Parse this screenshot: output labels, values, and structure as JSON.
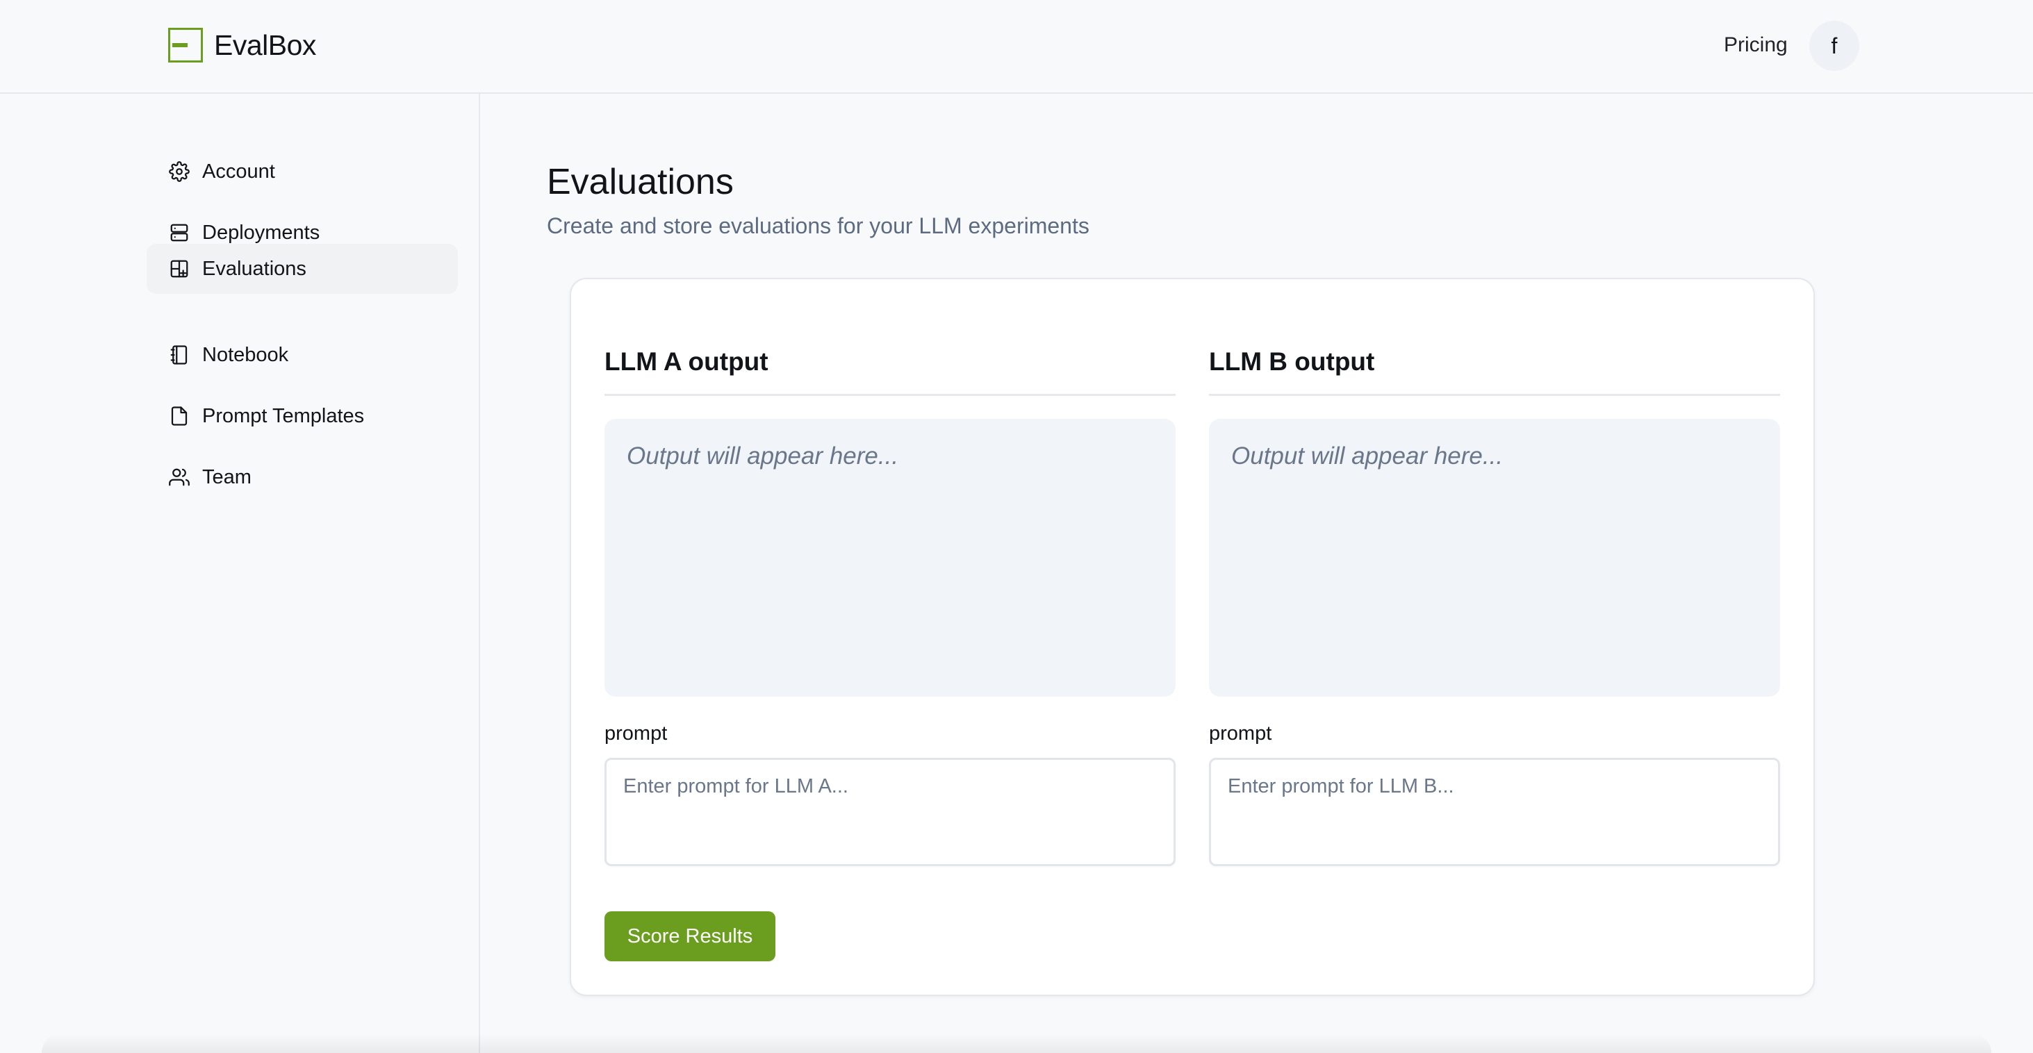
{
  "header": {
    "brand": "EvalBox",
    "pricing_label": "Pricing",
    "avatar_initial": "f",
    "brand_color": "#6b9e1f"
  },
  "sidebar": {
    "items": [
      {
        "label": "Account",
        "icon": "gear-icon",
        "active": false
      },
      {
        "label": "Deployments",
        "icon": "server-icon",
        "active": false
      },
      {
        "label": "Evaluations",
        "icon": "layout-plus-icon",
        "active": true
      },
      {
        "label": "Notebook",
        "icon": "notebook-icon",
        "active": false
      },
      {
        "label": "Prompt Templates",
        "icon": "file-icon",
        "active": false
      },
      {
        "label": "Team",
        "icon": "users-icon",
        "active": false
      }
    ]
  },
  "main": {
    "title": "Evaluations",
    "subtitle": "Create and store evaluations for your LLM experiments",
    "columns": [
      {
        "title": "LLM A output",
        "output_placeholder": "Output will appear here...",
        "prompt_label": "prompt",
        "prompt_placeholder": "Enter prompt for LLM A...",
        "prompt_value": ""
      },
      {
        "title": "LLM B output",
        "output_placeholder": "Output will appear here...",
        "prompt_label": "prompt",
        "prompt_placeholder": "Enter prompt for LLM B...",
        "prompt_value": ""
      }
    ],
    "score_button_label": "Score Results"
  }
}
